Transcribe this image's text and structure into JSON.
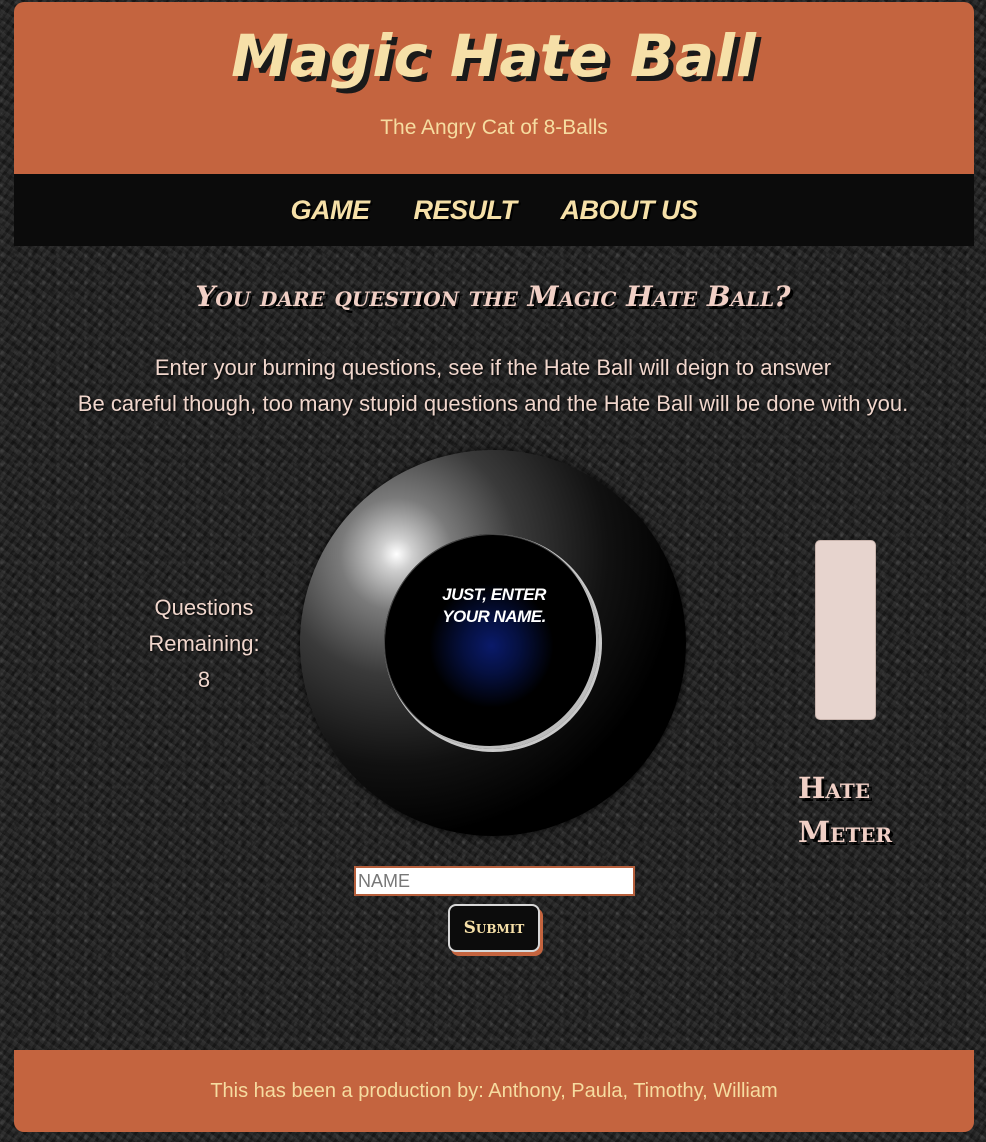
{
  "header": {
    "title": "Magic Hate Ball",
    "subtitle": "The Angry Cat of 8-Balls"
  },
  "nav": {
    "items": [
      {
        "label": "GAME"
      },
      {
        "label": "RESULT"
      },
      {
        "label": "ABOUT US"
      }
    ]
  },
  "main": {
    "heading": "You dare question the Magic Hate Ball?",
    "intro_line1": "Enter your burning questions, see if the Hate Ball will deign to answer",
    "intro_line2": "Be careful though, too many stupid questions and the Hate Ball will be done with you.",
    "questions_remaining_label_1": "Questions",
    "questions_remaining_label_2": "Remaining:",
    "questions_remaining_value": "8",
    "ball_message_line1": "Just, enter",
    "ball_message_line2": "your name.",
    "hate_meter_label_1": "Hate",
    "hate_meter_label_2": "Meter",
    "hate_meter_level": 0
  },
  "form": {
    "name_placeholder": "NAME",
    "name_value": "",
    "submit_label": "Submit"
  },
  "footer": {
    "text": "This has been a production by: Anthony, Paula, Timothy, William"
  },
  "colors": {
    "header_bg": "#c4643f",
    "nav_bg": "#0b0b0b",
    "accent_text": "#f6e0a8",
    "meter_fill": "#e7d4ce"
  }
}
